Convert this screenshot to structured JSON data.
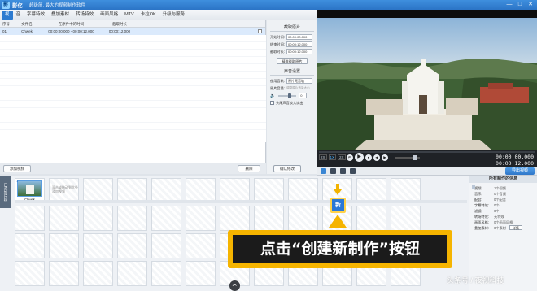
{
  "window": {
    "app_name": "影亿",
    "slogan": "超级简, 最大的视频制作软件",
    "controls": [
      "—",
      "□",
      "✕"
    ]
  },
  "menu": {
    "items": [
      "视",
      "音",
      "字幕特效",
      "叠加素材",
      "转场特效",
      "画面风格",
      "MTV",
      "卡拉OK",
      "升级与服务"
    ]
  },
  "filelist": {
    "columns": [
      "序号",
      "文件名",
      "在原件中的时间",
      "截取时长"
    ],
    "rows": [
      {
        "num": "01",
        "name": "Chwek",
        "start": "00:00:00.000 - 00:00:12.000",
        "dur": "00:00:12.000"
      }
    ],
    "add_button": "添加视频",
    "delete_button": "删除"
  },
  "settings": {
    "clip_section": "截取原片",
    "start_label": "开始时间:",
    "start_value": "00:00:00.000",
    "end_label": "结束时间:",
    "end_value": "00:00:12.000",
    "length_label": "截取时长:",
    "length_value": "00:00:12.000",
    "precise_button": "精准截取原片",
    "audio_section": "声音设置",
    "track_label": "使用音轨:",
    "track_value": "原片无音轨",
    "volume_label": "原片音量:",
    "volume_hint": "调整原片音量大小",
    "volume_value": "0",
    "fade_label": "头尾声音淡入淡出",
    "confirm_button": "确认修改"
  },
  "player": {
    "toggles": [
      "2X",
      "1X",
      "2X"
    ],
    "buttons": [
      "⏮",
      "▶",
      "⏹",
      "◀",
      "▶"
    ],
    "time_current": "00:00:00.000",
    "time_total": "00:00:12.000"
  },
  "preview_tools": {
    "export_button": "导出视频"
  },
  "timeline": {
    "side_label": "已添加片段",
    "clip_label": "Chwek",
    "clip_num": "1",
    "drop_hint": "双击或拖动到此处 添加视频"
  },
  "info": {
    "title": "所有制作的信息",
    "rows": [
      {
        "k": "视频:",
        "v": "1个视频"
      },
      {
        "k": "音乐:",
        "v": "0个音频"
      },
      {
        "k": "配音:",
        "v": "0个配音"
      },
      {
        "k": "字幕特效:",
        "v": "0个"
      },
      {
        "k": "滤镜:",
        "v": "0个"
      },
      {
        "k": "转场特效:",
        "v": "无特效"
      },
      {
        "k": "画面风格:",
        "v": "0个画面风格"
      },
      {
        "k": "叠加素材:",
        "v": "0个素材"
      }
    ],
    "more_button": "详情"
  },
  "create_button": {
    "label": "新",
    "name": "创建新制作"
  },
  "callout": {
    "text": "点击“创建新制作”按钮"
  },
  "watermark": "头条号 / 夜视科技"
}
